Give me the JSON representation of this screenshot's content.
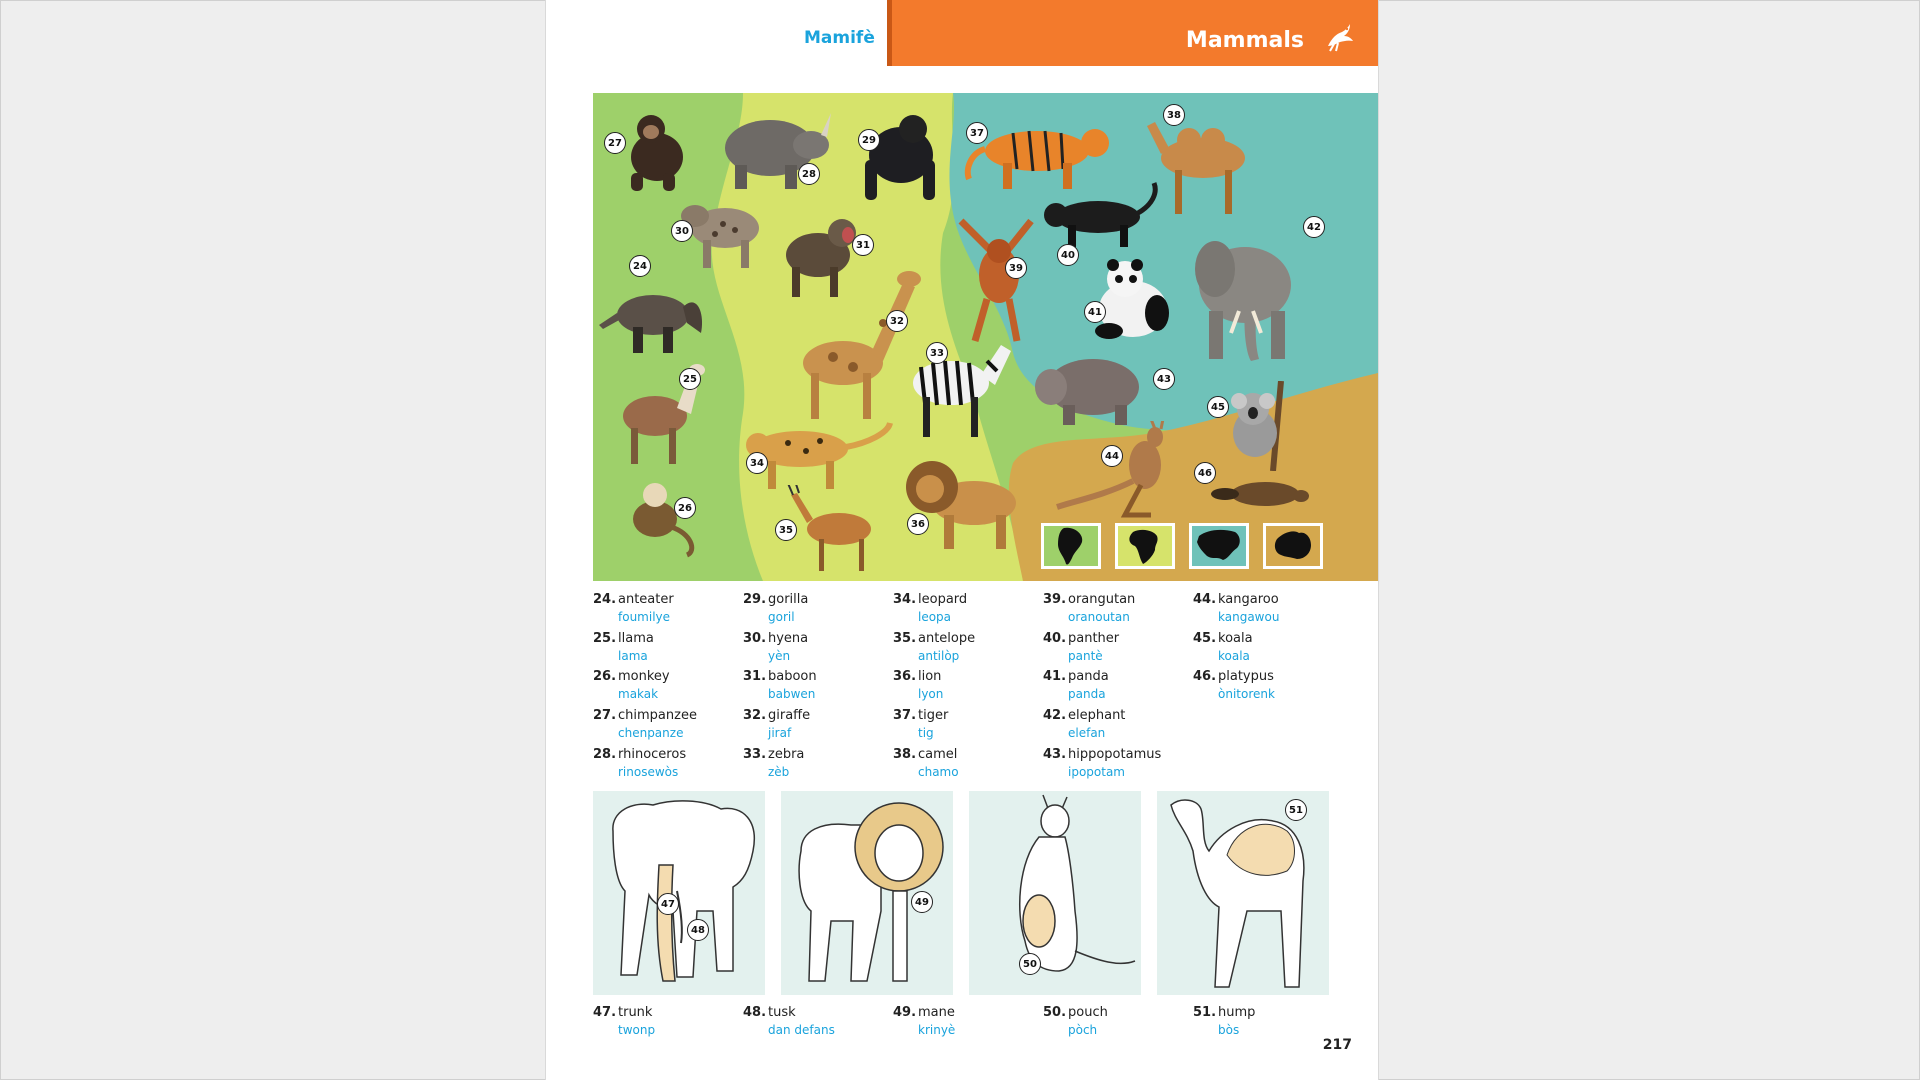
{
  "header": {
    "left_title": "Mamifè",
    "right_title": "Mammals",
    "icon": "bird-logo-icon"
  },
  "scene": {
    "background_colors": [
      "#9ed06a",
      "#d6e36b",
      "#6fc2b9",
      "#d4a84e"
    ],
    "labels": [
      "27",
      "28",
      "29",
      "30",
      "31",
      "24",
      "32",
      "33",
      "25",
      "34",
      "26",
      "35",
      "36",
      "37",
      "38",
      "39",
      "40",
      "41",
      "42",
      "43",
      "44",
      "45",
      "46"
    ],
    "continents": [
      "south-america-icon",
      "africa-icon",
      "asia-icon",
      "australia-icon"
    ]
  },
  "vocabulary": [
    {
      "num": "24.",
      "en": "anteater",
      "ht": "foumilye"
    },
    {
      "num": "25.",
      "en": "llama",
      "ht": "lama"
    },
    {
      "num": "26.",
      "en": "monkey",
      "ht": "makak"
    },
    {
      "num": "27.",
      "en": "chimpanzee",
      "ht": "chenpanze"
    },
    {
      "num": "28.",
      "en": "rhinoceros",
      "ht": "rinosewòs"
    },
    {
      "num": "29.",
      "en": "gorilla",
      "ht": "goril"
    },
    {
      "num": "30.",
      "en": "hyena",
      "ht": "yèn"
    },
    {
      "num": "31.",
      "en": "baboon",
      "ht": "babwen"
    },
    {
      "num": "32.",
      "en": "giraffe",
      "ht": "jiraf"
    },
    {
      "num": "33.",
      "en": "zebra",
      "ht": "zèb"
    },
    {
      "num": "34.",
      "en": "leopard",
      "ht": "leopa"
    },
    {
      "num": "35.",
      "en": "antelope",
      "ht": "antilòp"
    },
    {
      "num": "36.",
      "en": "lion",
      "ht": "lyon"
    },
    {
      "num": "37.",
      "en": "tiger",
      "ht": "tig"
    },
    {
      "num": "38.",
      "en": "camel",
      "ht": "chamo"
    },
    {
      "num": "39.",
      "en": "orangutan",
      "ht": "oranoutan"
    },
    {
      "num": "40.",
      "en": "panther",
      "ht": "pantè"
    },
    {
      "num": "41.",
      "en": "panda",
      "ht": "panda"
    },
    {
      "num": "42.",
      "en": "elephant",
      "ht": "elefan"
    },
    {
      "num": "43.",
      "en": "hippopotamus",
      "ht": "ipopotam"
    },
    {
      "num": "44.",
      "en": "kangaroo",
      "ht": "kangawou"
    },
    {
      "num": "45.",
      "en": "koala",
      "ht": "koala"
    },
    {
      "num": "46.",
      "en": "platypus",
      "ht": "ònitorenk"
    }
  ],
  "panels": [
    {
      "animal": "elephant-drawing",
      "labels": [
        "47",
        "48"
      ]
    },
    {
      "animal": "lion-drawing",
      "labels": [
        "49"
      ]
    },
    {
      "animal": "kangaroo-drawing",
      "labels": [
        "50"
      ]
    },
    {
      "animal": "camel-drawing",
      "labels": [
        "51"
      ]
    }
  ],
  "parts": [
    {
      "num": "47.",
      "en": "trunk",
      "ht": "twonp"
    },
    {
      "num": "48.",
      "en": "tusk",
      "ht": "dan defans"
    },
    {
      "num": "49.",
      "en": "mane",
      "ht": "krinyè"
    },
    {
      "num": "50.",
      "en": "pouch",
      "ht": "pòch"
    },
    {
      "num": "51.",
      "en": "hump",
      "ht": "bòs"
    }
  ],
  "page_number": "217"
}
